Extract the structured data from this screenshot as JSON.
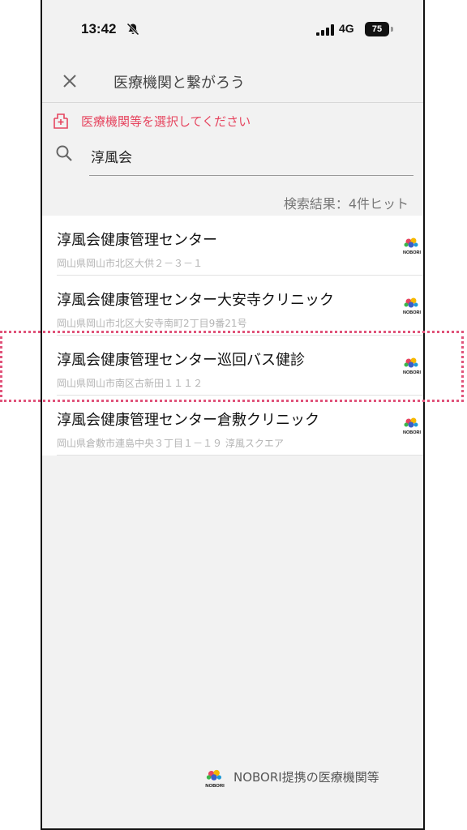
{
  "status_bar": {
    "time": "13:42",
    "network": "4G",
    "battery": "75",
    "icons": [
      "bell-off-icon",
      "signal-icon",
      "battery-icon"
    ]
  },
  "header": {
    "title": "医療機関と繋がろう",
    "close_icon": "close-icon"
  },
  "prompt": {
    "text": "医療機関等を選択してください",
    "icon": "hospital-icon",
    "color": "#e6455f"
  },
  "search": {
    "value": "淳風会",
    "icon": "search-icon"
  },
  "results": {
    "count_label": "検索結果：4件ヒット",
    "items": [
      {
        "name": "淳風会健康管理センター",
        "address": "岡山県岡山市北区大供２－３－１",
        "logo": "NOBORI"
      },
      {
        "name": "淳風会健康管理センター大安寺クリニック",
        "address": "岡山県岡山市北区大安寺南町2丁目9番21号",
        "logo": "NOBORI"
      },
      {
        "name": "淳風会健康管理センター巡回バス健診",
        "address": "岡山県岡山市南区古新田１１１２",
        "logo": "NOBORI"
      },
      {
        "name": "淳風会健康管理センター倉敷クリニック",
        "address": "岡山県倉敷市連島中央３丁目１－１９ 淳風スクエア",
        "logo": "NOBORI"
      }
    ]
  },
  "footer": {
    "text": "NOBORI提携の医療機関等",
    "logo": "NOBORI"
  },
  "colors": {
    "accent": "#e6455f",
    "background": "#f2f2f2",
    "highlight": "#e0537a"
  }
}
